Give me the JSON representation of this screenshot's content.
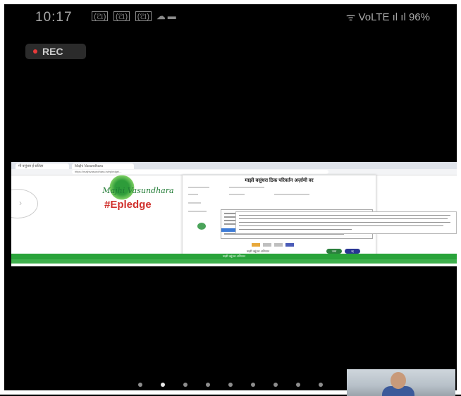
{
  "statusbar": {
    "time": "10:17",
    "small_icons": [
      "(ଅ)",
      "(ଅ)",
      "(ଅ)"
    ],
    "cloud_icon": "cloud-icon",
    "image_icon": "image-icon",
    "right_text": "ᯤ VoLTE ıl ıl 96%"
  },
  "recording": {
    "label": "REC"
  },
  "browser": {
    "tab1_label": "मी वसुंधरा ई-प्रतिज्ञा",
    "tab2_label": "Majhi Vasundhara",
    "url": "https://majhivasundhara.in/epledge/..."
  },
  "website": {
    "logo_text": "Majhi Vasundhara",
    "logo_tag": "#Epledge",
    "dialog_title": "माझी वसुंधरा ठिक परिवर्तन अर्ज़ामी वर",
    "ok_label": "जमा",
    "cancel_label": "रद्द",
    "below_text": "माझी वसुंधरा अभियान",
    "green_bar_text": "माझी वसुंधरा अभियान"
  },
  "pager": {
    "count": 9,
    "active_index": 1
  }
}
